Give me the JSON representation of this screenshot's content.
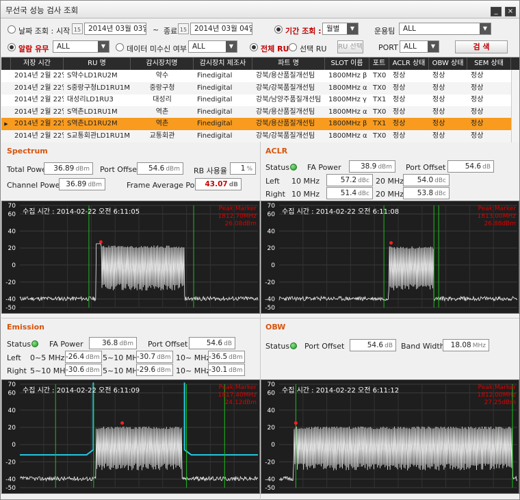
{
  "window": {
    "title": "무선국 성능 검사 조회"
  },
  "filters": {
    "date_label": "날짜 조회 :",
    "start_label": "시작",
    "start_date": "2014년 03월 03일",
    "tilde": "~",
    "end_label": "종료",
    "end_date": "2014년 03월 04일",
    "period_label": "기간 조회 :",
    "period_value": "월별",
    "team_label": "운용팀",
    "team_value": "ALL",
    "alarm_label": "알람 유무",
    "alarm_value": "ALL",
    "missing_label": "데이터 미수신 여부",
    "missing_value": "ALL",
    "all_ru_label": "전체 RU",
    "select_ru_label": "선택 RU",
    "ru_select_button": "RU 선택",
    "port_label": "PORT",
    "port_value": "ALL",
    "search_button": "검 색"
  },
  "table": {
    "columns": [
      "저장 시간",
      "RU 명",
      "감시장치명",
      "감시장치 제조사",
      "파트 명",
      "SLOT 이름",
      "포트",
      "ACLR 상태",
      "OBW 상태",
      "SEM 상태"
    ],
    "rows": [
      [
        "2014년 2월 22일",
        "S약수LD1RU2M",
        "약수",
        "Finedigital",
        "강북/용산품질개선팀",
        "1800MHz β",
        "TX0",
        "정상",
        "정상",
        "정상"
      ],
      [
        "2014년 2월 22일",
        "S중랑구청LD1RU1M",
        "중랑구청",
        "Finedigital",
        "강북/강북품질개선팀",
        "1800MHz α",
        "TX0",
        "정상",
        "정상",
        "정상"
      ],
      [
        "2014년 2월 22일",
        "대성리LD1RU3",
        "대성리",
        "Finedigital",
        "강북/남양주품질개선팀",
        "1800MHz γ",
        "TX1",
        "정상",
        "정상",
        "정상"
      ],
      [
        "2014년 2월 22일",
        "S역촌LD1RU1M",
        "역촌",
        "Finedigital",
        "강북/용산품질개선팀",
        "1800MHz α",
        "TX0",
        "정상",
        "정상",
        "정상"
      ],
      [
        "2014년 2월 22일",
        "S역촌LD1RU2M",
        "역촌",
        "Finedigital",
        "강북/용산품질개선팀",
        "1800MHz β",
        "TX1",
        "정상",
        "정상",
        "정상"
      ],
      [
        "2014년 2월 22일",
        "S교통회관LD1RU1M",
        "교통회관",
        "Finedigital",
        "강북/강북품질개선팀",
        "1800MHz α",
        "TX0",
        "정상",
        "정상",
        "정상"
      ]
    ],
    "selected_row": 4
  },
  "spectrum": {
    "title": "Spectrum",
    "total_power_label": "Total Power",
    "total_power": "36.89",
    "total_power_unit": "dBm",
    "port_offset_label": "Port Offset",
    "port_offset": "54.6",
    "port_offset_unit": "dBm",
    "rb_label": "RB 사용율",
    "rb_value": "1",
    "rb_unit": "%",
    "channel_power_label": "Channel Power",
    "channel_power": "36.89",
    "channel_power_unit": "dBm",
    "frame_avg_label": "Frame Average Power",
    "frame_avg": "43.07",
    "frame_avg_unit": "dB",
    "time": "수집 시간 : 2014-02-22 오전 6:11:05",
    "peak_label": "Peak Marker",
    "peak_freq": "1812.70MHz",
    "peak_level": "26.08dBm"
  },
  "aclr": {
    "title": "ACLR",
    "status_label": "Status",
    "fa_power_label": "FA Power",
    "fa_power": "38.9",
    "fa_power_unit": "dBm",
    "port_offset_label": "Port Offset",
    "port_offset": "54.6",
    "port_offset_unit": "dB",
    "left_label": "Left",
    "right_label": "Right",
    "b10_label": "10 MHz",
    "b20_label": "20 MHz",
    "left_10": "57.2",
    "left_20": "54.0",
    "right_10": "51.4",
    "right_20": "53.8",
    "unit": "dBc",
    "time": "수집 시간 : 2014-02-22 오전 6:11:08",
    "peak_label": "Peak Marker",
    "peak_freq": "1813.00MHz",
    "peak_level": "26.88dBm"
  },
  "emission": {
    "title": "Emission",
    "status_label": "Status",
    "fa_power_label": "FA Power",
    "fa_power": "36.8",
    "fa_power_unit": "dBm",
    "port_offset_label": "Port Offset",
    "port_offset": "54.6",
    "port_offset_unit": "dB",
    "left_label": "Left",
    "right_label": "Right",
    "b1_label": "0~5 MHz",
    "b1r_label": "5~10 MHz",
    "b2_label": "5~10 MHz",
    "b3_label": "10~ MHz",
    "left_1": "-26.4",
    "left_2": "-30.7",
    "left_3": "-36.5",
    "right_1": "-30.6",
    "right_2": "-29.6",
    "right_3": "-30.1",
    "unit": "dBm",
    "time": "수집 시간 : 2014-02-22 오전 6:11:09",
    "peak_label": "Peak Marker",
    "peak_freq": "1817.40MHz",
    "peak_level": "24.12dBm"
  },
  "obw": {
    "title": "OBW",
    "status_label": "Status",
    "port_offset_label": "Port Offset",
    "port_offset": "54.6",
    "port_offset_unit": "dB",
    "bw_label": "Band Width",
    "bw_value": "18.08",
    "bw_unit": "MHz",
    "time": "수집 시간 : 2014-02-22 오전 6:11:12",
    "peak_label": "Peak Marker",
    "peak_freq": "1812.00MHz",
    "peak_level": "27.25dBm"
  },
  "plot_axis": {
    "ymin": -50,
    "ymax": 70,
    "ticks": [
      "70",
      "60",
      "40",
      "20",
      "0",
      "-20",
      "-40",
      "-50"
    ]
  },
  "colors": {
    "accent": "#f89b1f",
    "title": "#d9530b",
    "trace": "#f2f2f2",
    "marker": "#ff2020",
    "limit": "#27c9e8",
    "gridline": "#1dbd1d",
    "status_ok": "#1c9a1c"
  }
}
